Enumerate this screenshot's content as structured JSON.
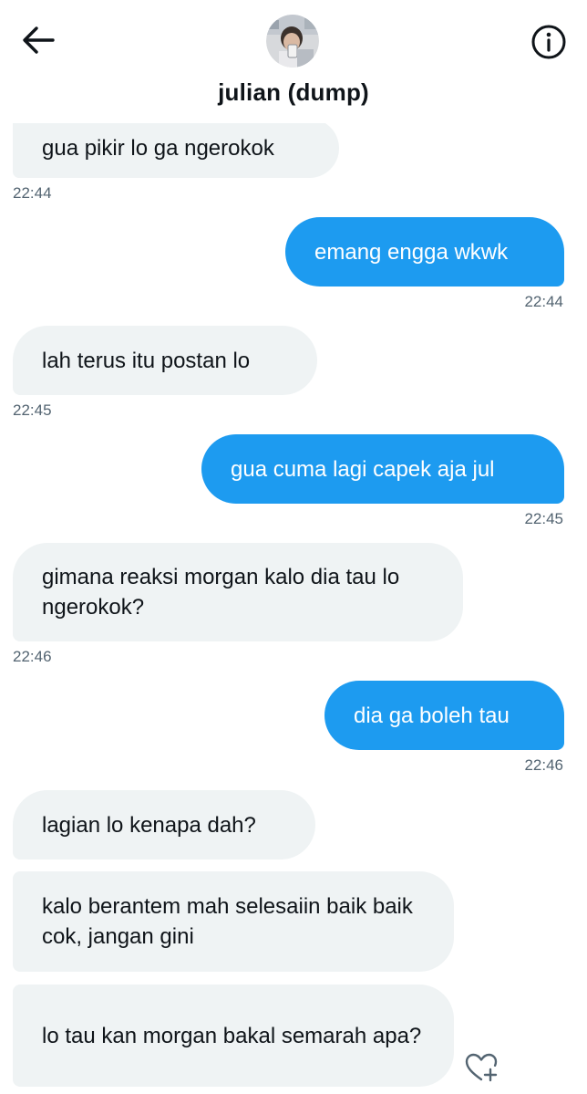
{
  "header": {
    "title": "julian (dump)",
    "back_icon": "arrow-left-icon",
    "info_icon": "info-circle-icon"
  },
  "colors": {
    "incoming_bubble": "#eff3f4",
    "outgoing_bubble": "#1d9bf0",
    "timestamp": "#536471",
    "text": "#0f1419"
  },
  "messages": [
    {
      "direction": "in",
      "text": "gua pikir lo ga ngerokok"
    },
    {
      "direction": "out",
      "text": "emang engga wkwk"
    },
    {
      "direction": "in",
      "text": "lah terus itu postan lo"
    },
    {
      "direction": "out",
      "text": "gua cuma lagi capek aja jul"
    },
    {
      "direction": "in",
      "text": "gimana reaksi morgan kalo dia tau lo ngerokok?"
    },
    {
      "direction": "out",
      "text": "dia ga boleh tau"
    },
    {
      "direction": "in",
      "text": "lagian lo kenapa dah?"
    },
    {
      "direction": "in",
      "text": "kalo berantem mah selesaiin baik baik cok, jangan gini"
    },
    {
      "direction": "in",
      "text": "lo tau kan morgan bakal semarah apa?"
    }
  ],
  "timestamps": [
    "22:44",
    "22:44",
    "22:45",
    "22:45",
    "22:46",
    "22:46"
  ],
  "react_icon": "heart-plus-icon"
}
